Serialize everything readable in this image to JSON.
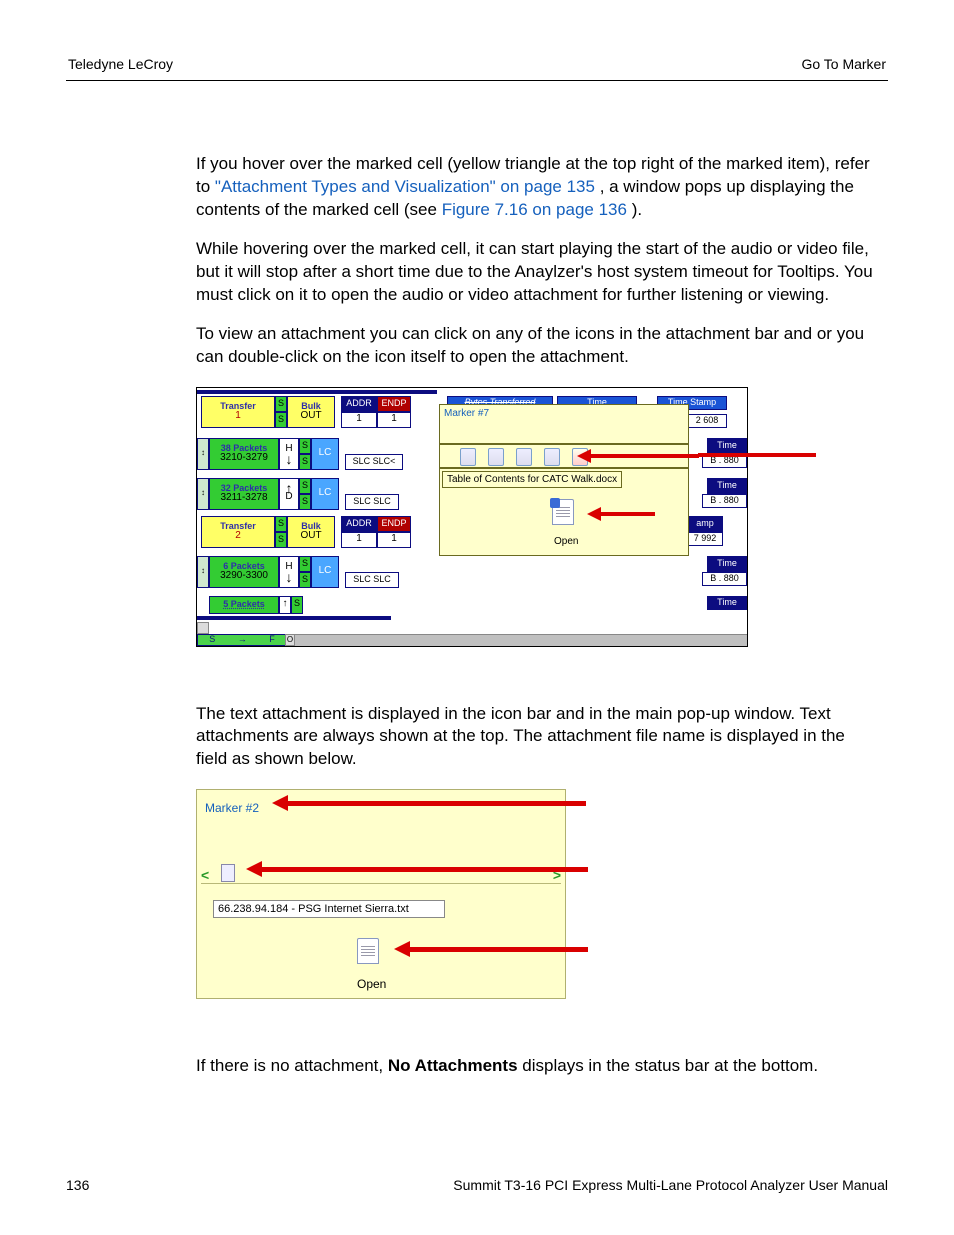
{
  "header": {
    "left": "Teledyne LeCroy",
    "right": "Go To Marker"
  },
  "footer": {
    "page": "136",
    "manual": "Summit T3-16 PCI Express Multi-Lane Protocol Analyzer User Manual"
  },
  "para": {
    "p1a": "If you hover over the marked cell (yellow triangle at the top right of the marked item), refer to ",
    "p1_link1": "\"Attachment Types and Visualization\" on page 135",
    "p1b": ", a window pops up displaying the contents of the marked cell (see ",
    "p1_link2": "Figure 7.16 on page 136",
    "p1c": ").",
    "p2": "While hovering over the marked cell, it can start playing the start of the audio or video file, but it will stop after a short time due to the Anaylzer's host system timeout for Tooltips. You must click on it to open the audio or video attachment for further listening or viewing.",
    "p3": "To view an attachment you can click on any of the icons in the attachment bar and or you can double-click on the icon itself to open the attachment.",
    "p4": "The text attachment is displayed in the icon bar and in the main pop-up window. Text attachments are always shown at the top. The attachment file name is displayed in the field as shown below.",
    "p5a": "If there is no attachment, ",
    "p5b": "No Attachments",
    "p5c": " displays in the status bar at the bottom."
  },
  "fig1": {
    "rows": [
      {
        "label1": "Transfer",
        "label2": "1",
        "col2a": "Bulk",
        "col2b": "OUT",
        "addr_h": "ADDR",
        "addr_v": "1",
        "endp_h": "ENDP",
        "endp_v": "1"
      },
      {
        "label1": "38 Packets",
        "label2": "3210-3279",
        "hv": "H",
        "lc": "LC",
        "slc": "SLC SLC<",
        "time_h": "Time",
        "time_v": "B . 880"
      },
      {
        "label1": "32 Packets",
        "label2": "3211-3278",
        "hv": "D",
        "lc": "LC",
        "slc": "SLC SLC",
        "time_h": "Time",
        "time_v": "B . 880"
      },
      {
        "label1": "Transfer",
        "label2": "2",
        "col2a": "Bulk",
        "col2b": "OUT",
        "addr_h": "ADDR",
        "addr_v": "1",
        "endp_h": "ENDP",
        "endp_v": "1",
        "amp_h": "amp",
        "amp_v": "7 992"
      },
      {
        "label1": "6 Packets",
        "label2": "3290-3300",
        "hv": "H",
        "lc": "LC",
        "slc": "SLC SLC",
        "time_h": "Time",
        "time_v": "B . 880"
      },
      {
        "label1": "5 Packets",
        "time_h": "Time"
      }
    ],
    "top_labels": {
      "bytes": "Bytes Transferred",
      "time": "Time",
      "tstamp": "Time Stamp",
      "tstamp_val": "2 608"
    },
    "marker": "Marker #7",
    "toc": "Table of Contents for CATC Walk.docx",
    "open": "Open",
    "status": {
      "s": "S",
      "arrow": "→",
      "f": "F",
      "o": "O"
    }
  },
  "fig2": {
    "marker": "Marker #2",
    "filename": "66.238.94.184 - PSG Internet Sierra.txt",
    "open": "Open"
  }
}
